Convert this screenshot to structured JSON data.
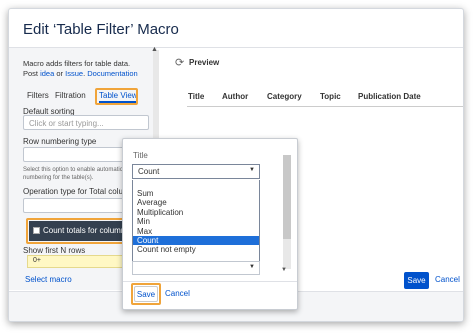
{
  "dialog": {
    "title": "Edit ‘Table Filter’ Macro"
  },
  "left": {
    "desc_line1": "Macro adds filters for table data.",
    "desc_post": "Post ",
    "desc_idea": "idea",
    "desc_or": " or ",
    "desc_issue": "Issue",
    "desc_doc": "Documentation",
    "tabs": [
      {
        "label": "Filters"
      },
      {
        "label": "Filtration"
      },
      {
        "label": "Table View"
      }
    ],
    "default_sorting_label": "Default sorting",
    "default_sorting_placeholder": "Click or start typing...",
    "row_numbering_label": "Row numbering type",
    "row_numbering_help": "Select this option to enable automatic numbering for the table(s).",
    "operation_label": "Operation type for Total column",
    "count_totals_label": "Count totals for columns",
    "show_first_label": "Show first N rows",
    "show_first_value": "0+",
    "select_macro": "Select macro"
  },
  "preview": {
    "label": "Preview",
    "columns": [
      "Title",
      "Author",
      "Category",
      "Topic",
      "Publication Date"
    ]
  },
  "footer": {
    "save": "Save",
    "cancel": "Cancel"
  },
  "popup": {
    "title": "Title",
    "selected": "Count",
    "options": [
      "Sum",
      "Average",
      "Multiplication",
      "Min",
      "Max",
      "Count",
      "Count not empty"
    ],
    "save": "Save",
    "cancel": "Cancel"
  },
  "colors": {
    "accent": "#0052cc",
    "highlight_box": "#f0a43a",
    "selected_option": "#1e6fd9"
  }
}
